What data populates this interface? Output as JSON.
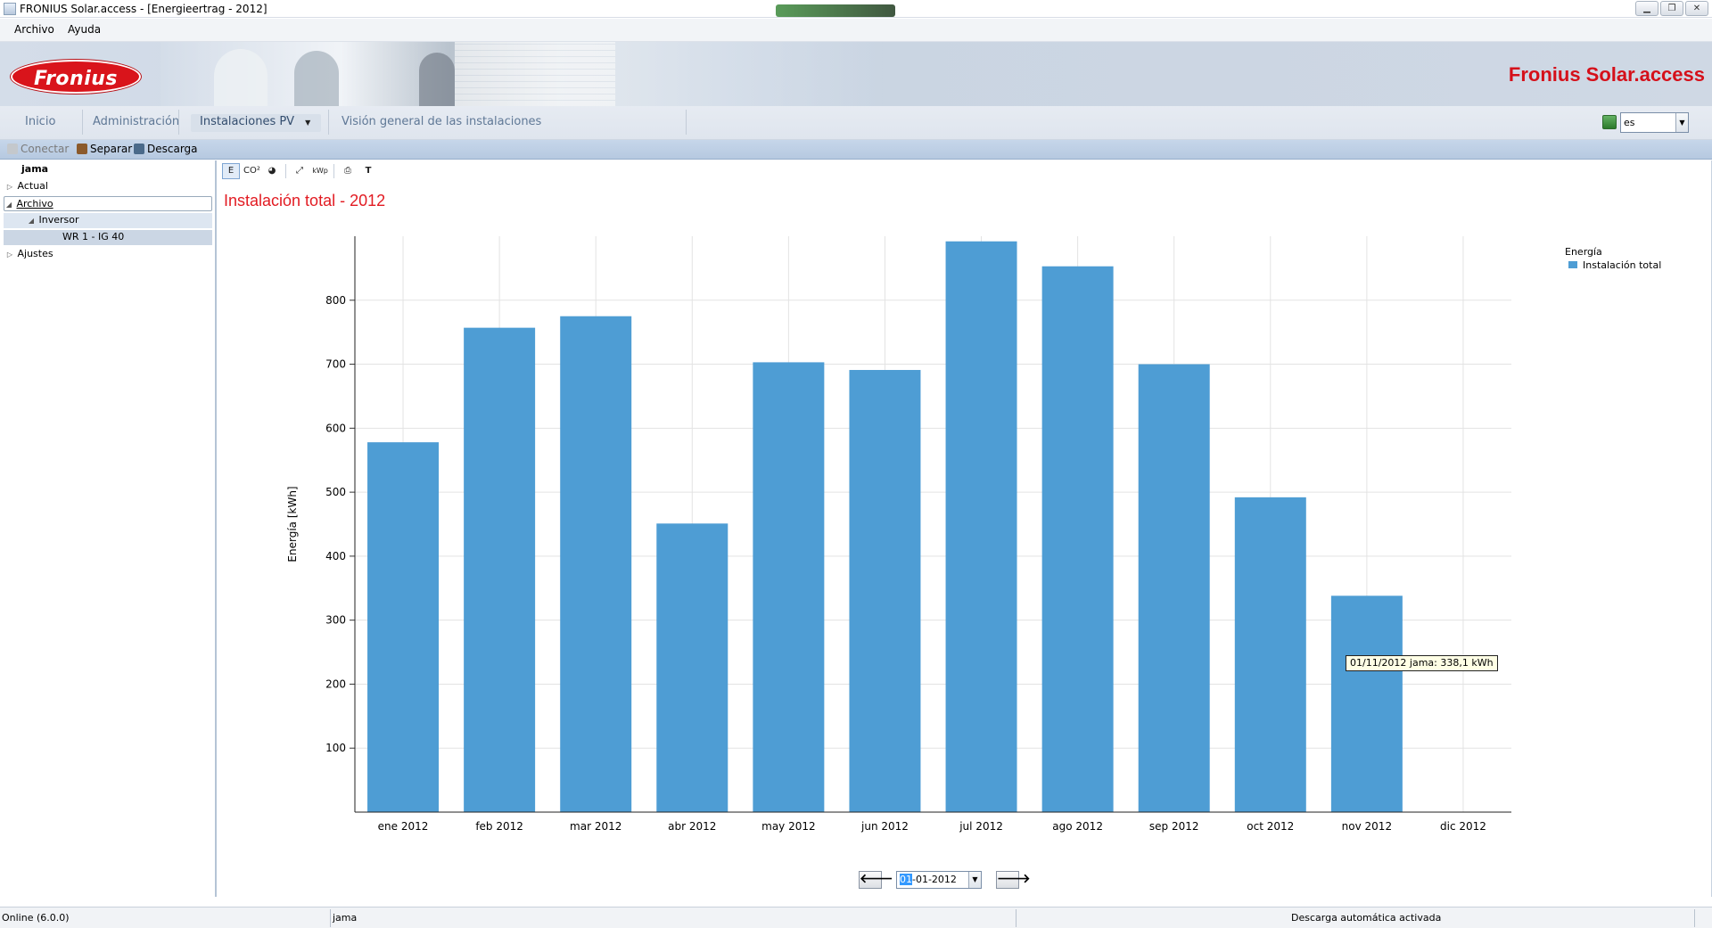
{
  "window": {
    "title": "FRONIUS Solar.access - [Energieertrag - 2012]",
    "buttons": [
      "▁",
      "❐",
      "✕"
    ]
  },
  "menu": {
    "items": [
      "Archivo",
      "Ayuda"
    ]
  },
  "banner": {
    "logo_text": "Fronius",
    "brand_title": "Fronius Solar.access"
  },
  "nav": {
    "tabs": [
      {
        "label": "Inicio"
      },
      {
        "label": "Administración"
      },
      {
        "label": "Instalaciones PV",
        "has_dropdown": true
      },
      {
        "label": "Visión general de las instalaciones"
      }
    ],
    "language": "es"
  },
  "connection_toolbar": {
    "connect": "Conectar",
    "disconnect": "Separar",
    "download": "Descarga"
  },
  "tree": {
    "root": "jama",
    "nodes": [
      {
        "label": "Actual",
        "expander": "▷"
      },
      {
        "label": "Archivo",
        "expander": "◢"
      },
      {
        "label": "Inversor",
        "expander": "◢"
      },
      {
        "label": "WR 1 - IG 40",
        "expander": ""
      },
      {
        "label": "Ajustes",
        "expander": "▷"
      }
    ]
  },
  "chart_toolbar": {
    "buttons": [
      "E",
      "CO²",
      "◕",
      "⤢",
      "kWp",
      "⎙",
      "T"
    ]
  },
  "chart_data": {
    "type": "bar",
    "title": "Instalación total - 2012",
    "ylabel": "Energía [kWh]",
    "xlabel": "",
    "categories": [
      "ene 2012",
      "feb 2012",
      "mar 2012",
      "abr 2012",
      "may 2012",
      "jun 2012",
      "jul 2012",
      "ago 2012",
      "sep 2012",
      "oct 2012",
      "nov 2012",
      "dic 2012"
    ],
    "series": [
      {
        "name": "Instalación total",
        "values": [
          578,
          757,
          775,
          451,
          703,
          691,
          892,
          853,
          700,
          492,
          338.1,
          0
        ],
        "color": "#4e9dd4"
      }
    ],
    "ylim": [
      0,
      900
    ],
    "yticks": [
      100,
      200,
      300,
      400,
      500,
      600,
      700,
      800
    ],
    "grid": true,
    "legend": {
      "title": "Energía",
      "position": "top-right"
    },
    "tooltip": "01/11/2012 jama: 338,1 kWh"
  },
  "date_nav": {
    "prev": "🡐",
    "next": "🡒",
    "date_selected": "01",
    "date_rest": "-01-2012"
  },
  "status": {
    "left": "Online (6.0.0)",
    "middle": "jama",
    "right": "Descarga automática activada"
  }
}
